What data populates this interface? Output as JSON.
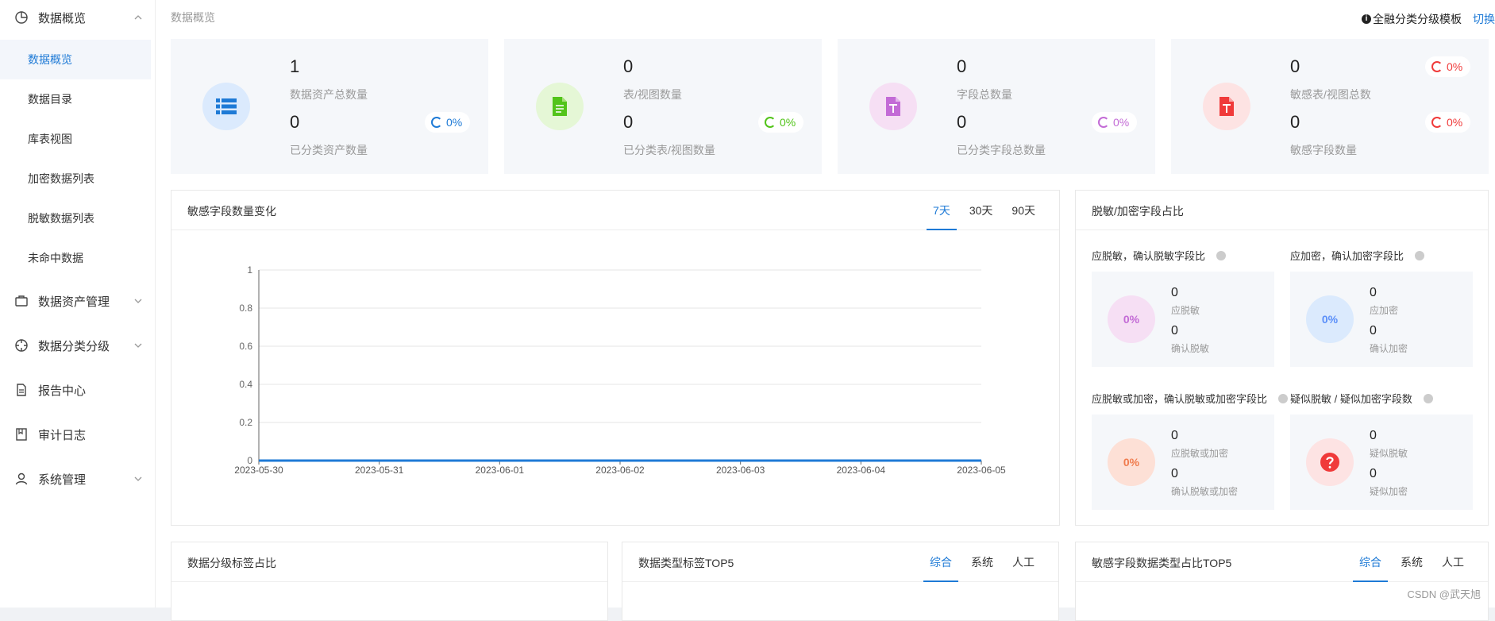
{
  "sidebar": {
    "groups": [
      {
        "label": "数据概览",
        "icon": "pie-chart-icon",
        "chevron": "up"
      },
      {
        "label": "数据资产管理",
        "icon": "briefcase-icon",
        "chevron": "down"
      },
      {
        "label": "数据分类分级",
        "icon": "target-icon",
        "chevron": "down"
      },
      {
        "label": "报告中心",
        "icon": "document-icon"
      },
      {
        "label": "审计日志",
        "icon": "book-icon"
      },
      {
        "label": "系统管理",
        "icon": "user-icon",
        "chevron": "down"
      }
    ],
    "sub_items": [
      "数据概览",
      "数据目录",
      "库表视图",
      "加密数据列表",
      "脱敏数据列表",
      "未命中数据"
    ]
  },
  "header": {
    "breadcrumb": "数据概览",
    "template_name": "全融分类分级模板",
    "switch_label": "切换"
  },
  "stats": [
    {
      "icon": "list-icon",
      "color": "#1e7ad6",
      "bg": "#dbeafd",
      "value1": "1",
      "label1": "数据资产总数量",
      "value2": "0",
      "label2": "已分类资产数量",
      "pct2": "0%"
    },
    {
      "icon": "file-icon",
      "color": "#52c41a",
      "bg": "#e5f7d6",
      "value1": "0",
      "label1": "表/视图数量",
      "value2": "0",
      "label2": "已分类表/视图数量",
      "pct2": "0%"
    },
    {
      "icon": "text-file-icon",
      "color": "#c36bd6",
      "bg": "#f6dff4",
      "value1": "0",
      "label1": "字段总数量",
      "value2": "0",
      "label2": "已分类字段总数量",
      "pct2": "0%"
    },
    {
      "icon": "text-file-icon",
      "color": "#f03a3a",
      "bg": "#fde3e3",
      "value1": "0",
      "label1": "敏感表/视图总数",
      "pct1": "0%",
      "value2": "0",
      "label2": "敏感字段数量",
      "pct2": "0%"
    }
  ],
  "trend_panel": {
    "title": "敏感字段数量变化",
    "tabs": [
      "7天",
      "30天",
      "90天"
    ],
    "active_tab": 0
  },
  "chart_data": {
    "type": "line",
    "title": "敏感字段数量变化",
    "xlabel": "",
    "ylabel": "",
    "x": [
      "2023-05-30",
      "2023-05-31",
      "2023-06-01",
      "2023-06-02",
      "2023-06-03",
      "2023-06-04",
      "2023-06-05"
    ],
    "series": [
      {
        "values": [
          0,
          0,
          0,
          0,
          0,
          0,
          0
        ],
        "color": "#1e7ad6"
      }
    ],
    "yticks": [
      "0",
      "0.2",
      "0.4",
      "0.6",
      "0.8",
      "1"
    ],
    "ylim": [
      0,
      1
    ],
    "grid": true
  },
  "ratio_panel": {
    "title": "脱敏/加密字段占比",
    "boxes": [
      {
        "subtitle": "应脱敏，确认脱敏字段比",
        "pct": "0%",
        "color": "#c36bd6",
        "bg": "#f6dff4",
        "v1": "0",
        "l1": "应脱敏",
        "v2": "0",
        "l2": "确认脱敏"
      },
      {
        "subtitle": "应加密，确认加密字段比",
        "pct": "0%",
        "color": "#5b8ff9",
        "bg": "#dbeafd",
        "v1": "0",
        "l1": "应加密",
        "v2": "0",
        "l2": "确认加密"
      },
      {
        "subtitle": "应脱敏或加密，确认脱敏或加密字段比",
        "pct": "0%",
        "color": "#f07c4e",
        "bg": "#fde0d6",
        "v1": "0",
        "l1": "应脱敏或加密",
        "v2": "0",
        "l2": "确认脱敏或加密"
      },
      {
        "subtitle": "疑似脱敏 / 疑似加密字段数",
        "icon": "question-icon",
        "color": "#f03a3a",
        "bg": "#fde3e3",
        "v1": "0",
        "l1": "疑似脱敏",
        "v2": "0",
        "l2": "疑似加密"
      }
    ]
  },
  "bottom_panels": [
    {
      "title": "数据分级标签占比"
    },
    {
      "title": "数据类型标签TOP5",
      "tabs": [
        "综合",
        "系统",
        "人工"
      ]
    },
    {
      "title": "敏感字段数据类型占比TOP5",
      "tabs": [
        "综合",
        "系统",
        "人工"
      ]
    }
  ],
  "watermark": "CSDN @武天旭"
}
